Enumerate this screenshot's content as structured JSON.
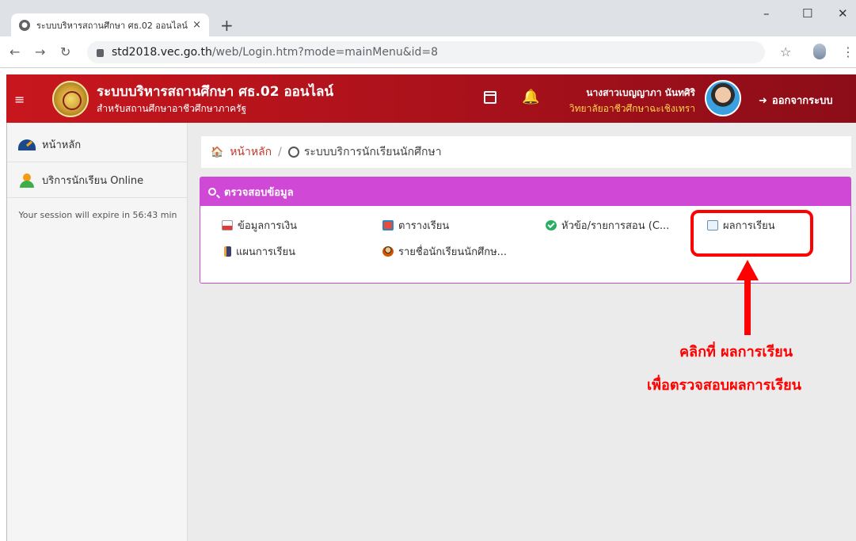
{
  "browser": {
    "tab_title": "ระบบบริหารสถานศึกษา ศธ.02 ออนไลน์",
    "tab_close": "×",
    "new_tab": "+",
    "url_host": "std2018.vec.go.th",
    "url_path": "/web/Login.htm?mode=mainMenu&id=8",
    "win_min": "–",
    "win_max": "☐",
    "win_close": "✕"
  },
  "header": {
    "hamburger": "≡",
    "title": "ระบบบริหารสถานศึกษา ศธ.02 ออนไลน์",
    "subtitle": "สำหรับสถานศึกษาอาชีวศึกษาภาครัฐ",
    "user_name": "นางสาวเบญญาภา นันทศิริ",
    "user_college": "วิทยาลัยอาชีวศึกษาฉะเชิงเทรา",
    "logout_label": "ออกจากระบบ"
  },
  "sidebar": {
    "items": [
      {
        "label": "หน้าหลัก"
      },
      {
        "label": "บริการนักเรียน Online"
      }
    ],
    "session_text": "Your session will expire in 56:43 min"
  },
  "breadcrumb": {
    "home": "หน้าหลัก",
    "separator": "/",
    "current": "ระบบบริการนักเรียนนักศึกษา"
  },
  "panel": {
    "title": "ตรวจสอบข้อมูล",
    "items": [
      {
        "label": "ข้อมูลการเงิน",
        "icon": "pdf-icon"
      },
      {
        "label": "ตารางเรียน",
        "icon": "timetable-icon"
      },
      {
        "label": "หัวข้อ/รายการสอน (C...",
        "icon": "check-circle-icon"
      },
      {
        "label": "ผลการเรียน",
        "icon": "document-icon"
      },
      {
        "label": "แผนการเรียน",
        "icon": "book-icon"
      },
      {
        "label": "รายชื่อนักเรียนนักศึกษ...",
        "icon": "teacher-icon"
      }
    ]
  },
  "annotation": {
    "line1": "คลิกที่ ผลการเรียน",
    "line2": "เพื่อตรวจสอบผลการเรียน",
    "color": "#ff0000"
  },
  "colors": {
    "header_red": "#c8161d",
    "panel_magenta": "#cf49d6",
    "breadcrumb_link": "#c0392b"
  }
}
